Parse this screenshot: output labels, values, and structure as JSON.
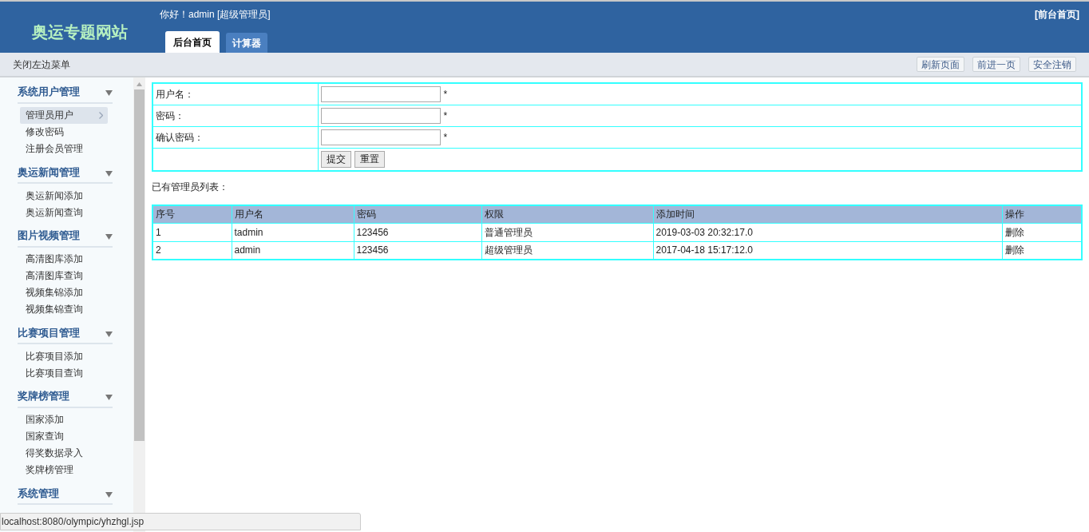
{
  "header": {
    "site_title": "奥运专题网站",
    "greeting": "你好！admin [超级管理员]",
    "front_link": "[前台首页]",
    "tabs": [
      {
        "label": "后台首页",
        "selected": true
      },
      {
        "label": "计算器",
        "selected": false
      }
    ]
  },
  "toolbar": {
    "toggle_menu": "关闭左边菜单",
    "buttons": [
      "刷新页面",
      "前进一页",
      "安全注销"
    ]
  },
  "sidebar": {
    "groups": [
      {
        "title": "系统用户管理",
        "items": [
          {
            "label": "管理员用户",
            "selected": true
          },
          {
            "label": "修改密码",
            "selected": false
          },
          {
            "label": "注册会员管理",
            "selected": false
          }
        ]
      },
      {
        "title": "奥运新闻管理",
        "items": [
          {
            "label": "奥运新闻添加",
            "selected": false
          },
          {
            "label": "奥运新闻查询",
            "selected": false
          }
        ]
      },
      {
        "title": "图片视频管理",
        "items": [
          {
            "label": "高清图库添加",
            "selected": false
          },
          {
            "label": "高清图库查询",
            "selected": false
          },
          {
            "label": "视频集锦添加",
            "selected": false
          },
          {
            "label": "视频集锦查询",
            "selected": false
          }
        ]
      },
      {
        "title": "比赛项目管理",
        "items": [
          {
            "label": "比赛项目添加",
            "selected": false
          },
          {
            "label": "比赛项目查询",
            "selected": false
          }
        ]
      },
      {
        "title": "奖牌榜管理",
        "items": [
          {
            "label": "国家添加",
            "selected": false
          },
          {
            "label": "国家查询",
            "selected": false
          },
          {
            "label": "得奖数据录入",
            "selected": false
          },
          {
            "label": "奖牌榜管理",
            "selected": false
          }
        ]
      },
      {
        "title": "系统管理"
      }
    ]
  },
  "form": {
    "fields": [
      {
        "label": "用户名：",
        "required_mark": "*"
      },
      {
        "label": "密码：",
        "required_mark": "*"
      },
      {
        "label": "确认密码：",
        "required_mark": "*"
      }
    ],
    "buttons": [
      "提交",
      "重置"
    ]
  },
  "list_title": "已有管理员列表：",
  "table": {
    "columns": [
      "序号",
      "用户名",
      "密码",
      "权限",
      "添加时间",
      "操作"
    ],
    "rows": [
      {
        "cells": [
          "1",
          "tadmin",
          "123456",
          "普通管理员",
          "2019-03-03 20:32:17.0"
        ],
        "action": "删除"
      },
      {
        "cells": [
          "2",
          "admin",
          "123456",
          "超级管理员",
          "2017-04-18 15:17:12.0"
        ],
        "action": "删除"
      }
    ]
  },
  "status_bar": "localhost:8080/olympic/yhzhgl.jsp"
}
